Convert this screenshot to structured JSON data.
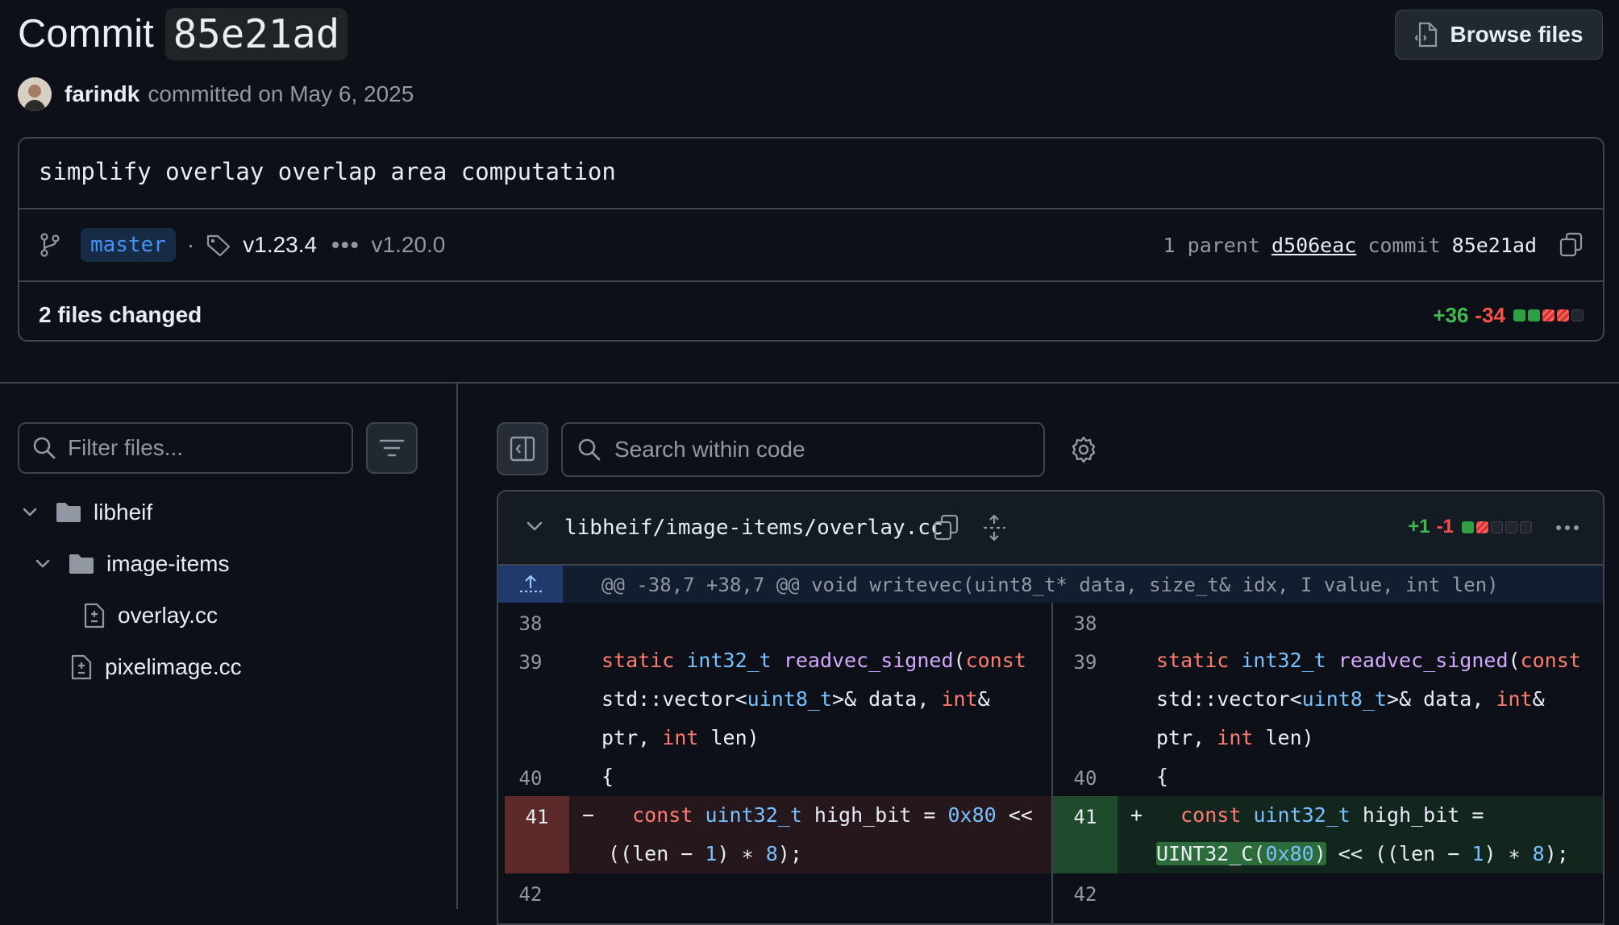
{
  "header": {
    "title_word": "Commit",
    "commit_sha": "85e21ad",
    "browse_files_label": "Browse files"
  },
  "author": {
    "name": "farindk",
    "committed_text": "committed on May 6, 2025"
  },
  "commit": {
    "message": "simplify overlay overlap area computation",
    "branch": "master",
    "tag_latest": "v1.23.4",
    "tag_oldest": "v1.20.0",
    "parent_label": "1 parent",
    "parent_sha": "d506eac",
    "commit_label": "commit",
    "commit_sha": "85e21ad",
    "files_changed": "2 files changed",
    "additions": "+36",
    "deletions": "-34",
    "diffstat_blocks": [
      "add",
      "add",
      "del",
      "del",
      "neutral"
    ]
  },
  "file_tree": {
    "filter_placeholder": "Filter files...",
    "items": [
      {
        "label": "libheif",
        "type": "folder",
        "expanded": true
      },
      {
        "label": "image-items",
        "type": "folder",
        "expanded": true
      },
      {
        "label": "overlay.cc",
        "type": "file"
      },
      {
        "label": "pixelimage.cc",
        "type": "file"
      }
    ]
  },
  "diff_toolbar": {
    "search_placeholder": "Search within code"
  },
  "diff_file": {
    "path": "libheif/image-items/overlay.cc",
    "additions": "+1",
    "deletions": "-1",
    "diffstat_blocks": [
      "add",
      "del",
      "neutral",
      "neutral",
      "neutral"
    ],
    "hunk_header": "@@ -38,7 +38,7 @@ void writevec(uint8_t* data, size_t& idx, I value, int len)",
    "line_numbers": [
      "38",
      "39",
      "40",
      "41",
      "42"
    ],
    "del_sign": "−",
    "add_sign": "+"
  },
  "colors": {
    "background": "#0d1117",
    "border": "#3d444d",
    "added": "#3fb950",
    "deleted": "#f85149",
    "branch_text": "#4493f8"
  }
}
